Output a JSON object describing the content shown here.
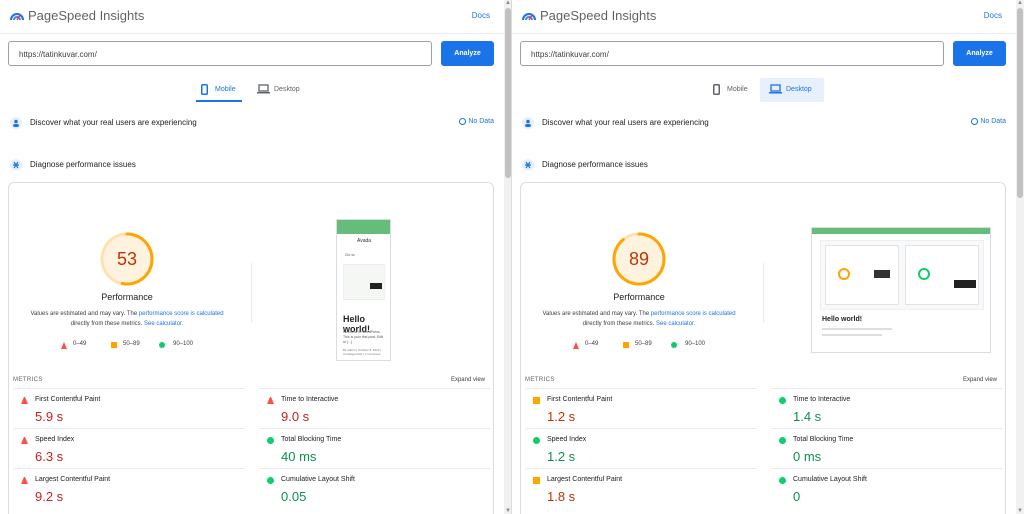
{
  "colors": {
    "accent": "#1a73e8",
    "fail": "#ff4e42",
    "average": "#ffa400",
    "pass": "#0cce6b"
  },
  "left": {
    "header": {
      "brand": "PageSpeed Insights",
      "docs": "Docs"
    },
    "url_input": {
      "value": "https://tatinkuvar.com/"
    },
    "analyze_label": "Analyze",
    "tabs": [
      {
        "label": "Mobile",
        "icon": "phone-icon",
        "active": true
      },
      {
        "label": "Desktop",
        "icon": "laptop-icon",
        "active": false
      }
    ],
    "real_users": {
      "text": "Discover what your real users are experiencing",
      "status": "No Data"
    },
    "diagnose": {
      "text": "Diagnose performance issues"
    },
    "score": {
      "value": "53",
      "fraction": 0.53,
      "label": "Performance",
      "color": "#ffa400"
    },
    "desc": {
      "pre": "Values are estimated and may vary. The",
      "link1": "performance score is calculated",
      "mid": "directly from these metrics.",
      "link2": "See calculator."
    },
    "legend": [
      "0–49",
      "50–89",
      "90–100"
    ],
    "metrics_title": "METRICS",
    "expand": "Expand view",
    "metrics": [
      {
        "name": "First Contentful Paint",
        "value": "5.9 s",
        "rating": "fail"
      },
      {
        "name": "Time to Interactive",
        "value": "9.0 s",
        "rating": "fail"
      },
      {
        "name": "Speed Index",
        "value": "6.3 s",
        "rating": "fail"
      },
      {
        "name": "Total Blocking Time",
        "value": "40 ms",
        "rating": "pass"
      },
      {
        "name": "Largest Contentful Paint",
        "value": "9.2 s",
        "rating": "fail"
      },
      {
        "name": "Cumulative Layout Shift",
        "value": "0.05",
        "rating": "pass"
      }
    ],
    "preview": {
      "site": "Avada",
      "menu": "Go to",
      "hello": "Hello world!",
      "body": "Welcome to WordPress. This is your first post. Edit or [...]",
      "meta": "By admin | October 8, 2022 | Uncategorized | 1 Comment"
    }
  },
  "right": {
    "header": {
      "brand": "PageSpeed Insights",
      "docs": "Docs"
    },
    "url_input": {
      "value": "https://tatinkuvar.com/"
    },
    "analyze_label": "Analyze",
    "tabs": [
      {
        "label": "Mobile",
        "icon": "phone-icon",
        "active": false
      },
      {
        "label": "Desktop",
        "icon": "laptop-icon",
        "active": true
      }
    ],
    "real_users": {
      "text": "Discover what your real users are experiencing",
      "status": "No Data"
    },
    "diagnose": {
      "text": "Diagnose performance issues"
    },
    "score": {
      "value": "89",
      "fraction": 0.89,
      "label": "Performance",
      "color": "#ffa400"
    },
    "desc": {
      "pre": "Values are estimated and may vary. The",
      "link1": "performance score is calculated",
      "mid": "directly from these metrics.",
      "link2": "See calculator."
    },
    "legend": [
      "0–49",
      "50–89",
      "90–100"
    ],
    "metrics_title": "METRICS",
    "expand": "Expand view",
    "metrics": [
      {
        "name": "First Contentful Paint",
        "value": "1.2 s",
        "rating": "average"
      },
      {
        "name": "Time to Interactive",
        "value": "1.4 s",
        "rating": "pass"
      },
      {
        "name": "Speed Index",
        "value": "1.2 s",
        "rating": "pass"
      },
      {
        "name": "Total Blocking Time",
        "value": "0 ms",
        "rating": "pass"
      },
      {
        "name": "Largest Contentful Paint",
        "value": "1.8 s",
        "rating": "average"
      },
      {
        "name": "Cumulative Layout Shift",
        "value": "0",
        "rating": "pass"
      }
    ],
    "preview": {
      "hello": "Hello world!"
    }
  }
}
